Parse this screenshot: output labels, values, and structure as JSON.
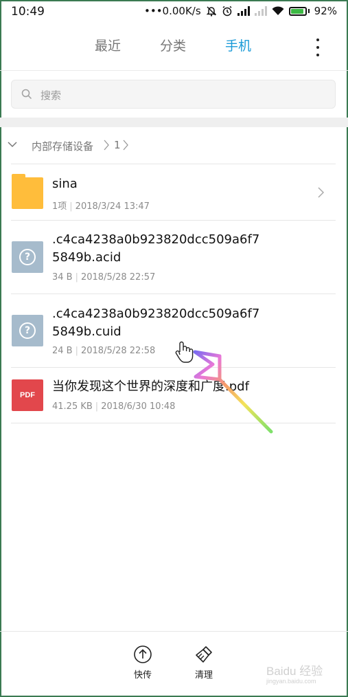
{
  "status_bar": {
    "time": "10:49",
    "net_speed": "•••0.00K/s",
    "battery_percent": "92%"
  },
  "tabs": [
    {
      "label": "最近",
      "active": false
    },
    {
      "label": "分类",
      "active": false
    },
    {
      "label": "手机",
      "active": true
    }
  ],
  "search": {
    "placeholder": "搜索"
  },
  "breadcrumb": {
    "root": "内部存储设备",
    "level": "1"
  },
  "files": [
    {
      "icon": "folder-icon",
      "name": "sina",
      "size": "1项",
      "date": "2018/3/24 13:47",
      "has_chevron": true
    },
    {
      "icon": "unknown-file-icon",
      "name_line1": ".c4ca4238a0b923820dcc509a6f7",
      "name_line2": "5849b.acid",
      "size": "34 B",
      "date": "2018/5/28 22:57"
    },
    {
      "icon": "unknown-file-icon",
      "name_line1": ".c4ca4238a0b923820dcc509a6f7",
      "name_line2": "5849b.cuid",
      "size": "24 B",
      "date": "2018/5/28 22:58"
    },
    {
      "icon": "pdf-icon",
      "badge": "PDF",
      "name": "当你发现这个世界的深度和广度.pdf",
      "size": "41.25 KB",
      "date": "2018/6/30 10:48"
    }
  ],
  "bottom_bar": {
    "transfer_label": "快传",
    "clean_label": "清理"
  },
  "watermark": {
    "brand": "Baidu 经验",
    "url": "jingyan.baidu.com"
  },
  "colors": {
    "accent": "#1a9ad7",
    "folder": "#ffbd3b",
    "unknown_file": "#a6bbcc",
    "pdf": "#e2474c",
    "battery": "#3db944"
  }
}
